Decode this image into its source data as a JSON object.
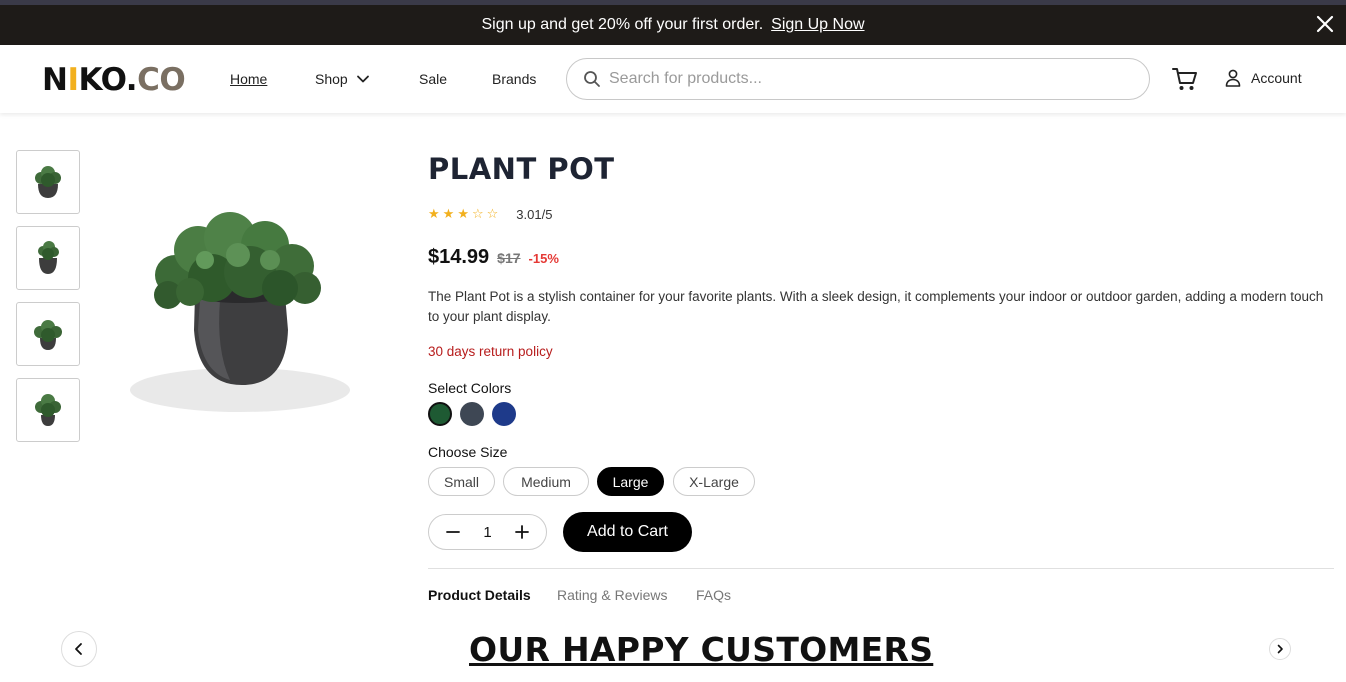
{
  "promo": {
    "text": "Sign up and get 20% off your first order.",
    "link": "Sign Up Now"
  },
  "header": {
    "logo": {
      "part1": "N",
      "part2": "I",
      "part3": "KO.",
      "part4": "CO"
    },
    "nav": {
      "home": "Home",
      "shop": "Shop",
      "sale": "Sale",
      "brands": "Brands"
    },
    "search_placeholder": "Search for products...",
    "account": "Account"
  },
  "product": {
    "title": "PLANT POT",
    "rating": {
      "stars": 3.01,
      "text": "3.01/5"
    },
    "price": "$14.99",
    "old_price": "$17",
    "discount": "-15%",
    "description": "The Plant Pot is a stylish container for your favorite plants. With a sleek design, it complements your indoor or outdoor garden, adding a modern touch to your plant display.",
    "policy": "30 days return policy",
    "colors_label": "Select Colors",
    "colors": [
      "#1e5a33",
      "#3e4754",
      "#1e3a8a"
    ],
    "selected_color": "#1e5a33",
    "size_label": "Choose Size",
    "sizes": [
      "Small",
      "Medium",
      "Large",
      "X-Large"
    ],
    "selected_size": "Large",
    "quantity": "1",
    "add_to_cart": "Add to Cart"
  },
  "tabs": {
    "details": "Product Details",
    "reviews": "Rating & Reviews",
    "faqs": "FAQs"
  },
  "customers_heading": "OUR HAPPY CUSTOMERS"
}
